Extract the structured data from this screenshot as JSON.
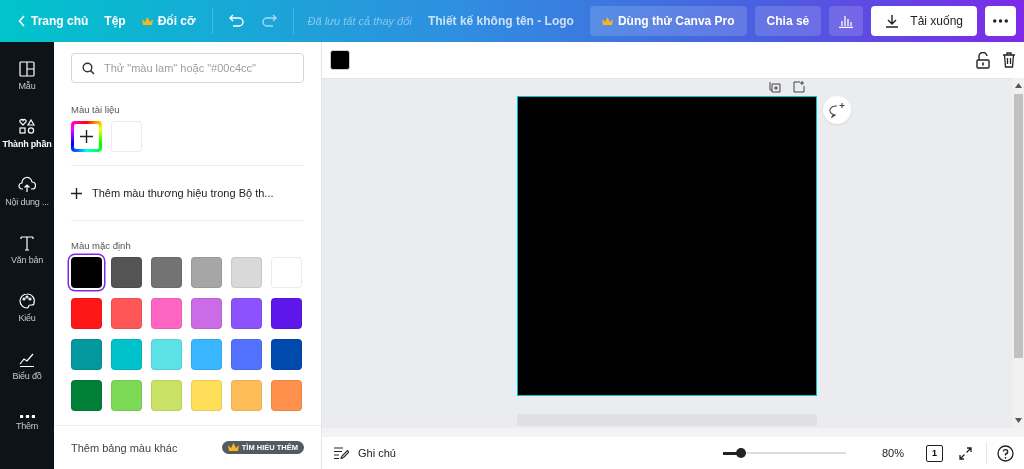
{
  "top_bar": {
    "back": "Trang chủ",
    "menu": [
      {
        "label": "Tệp",
        "kind": "plain"
      },
      {
        "label": "Đổi cỡ",
        "kind": "crown"
      }
    ],
    "save_status": "Đã lưu tất cả thay đổi",
    "title": "Thiết kế không tên - Logo",
    "pro_button": "Dùng thử Canva Pro",
    "share_button": "Chia sẻ",
    "download_button": "Tải xuống"
  },
  "sidebar": {
    "items": [
      {
        "label": "Mẫu",
        "selected": false
      },
      {
        "label": "Thành phần",
        "selected": true
      },
      {
        "label": "Nội dung ...",
        "selected": false
      },
      {
        "label": "Văn bản",
        "selected": false
      },
      {
        "label": "Kiểu",
        "selected": false
      },
      {
        "label": "Biểu đồ",
        "selected": false
      },
      {
        "label": "Thêm",
        "selected": false
      }
    ]
  },
  "panel": {
    "search": {
      "placeholder": "Thử \"màu lam\" hoặc \"#00c4cc\""
    },
    "document_colors_label": "Màu tài liệu",
    "document_colors": [
      {
        "color": "#ffffff"
      }
    ],
    "brand_link": "Thêm màu thương hiệu trong Bộ th...",
    "default_colors_label": "Màu mặc định",
    "default_colors": [
      {
        "color": "#000000",
        "selected": true
      },
      {
        "color": "#545454",
        "selected": false
      },
      {
        "color": "#737373",
        "selected": false
      },
      {
        "color": "#a6a6a6",
        "selected": false
      },
      {
        "color": "#d9d9d9",
        "selected": false
      },
      {
        "color": "#ffffff",
        "selected": false
      },
      {
        "color": "#ff1616",
        "selected": false
      },
      {
        "color": "#ff5757",
        "selected": false
      },
      {
        "color": "#ff66c4",
        "selected": false
      },
      {
        "color": "#cb6ce6",
        "selected": false
      },
      {
        "color": "#8c52ff",
        "selected": false
      },
      {
        "color": "#5e17eb",
        "selected": false
      },
      {
        "color": "#03989e",
        "selected": false
      },
      {
        "color": "#00c2cb",
        "selected": false
      },
      {
        "color": "#5ce1e6",
        "selected": false
      },
      {
        "color": "#38b6ff",
        "selected": false
      },
      {
        "color": "#5271ff",
        "selected": false
      },
      {
        "color": "#004aad",
        "selected": false
      },
      {
        "color": "#008037",
        "selected": false
      },
      {
        "color": "#7ed957",
        "selected": false
      },
      {
        "color": "#c9e265",
        "selected": false
      },
      {
        "color": "#ffde59",
        "selected": false
      },
      {
        "color": "#ffbd59",
        "selected": false
      },
      {
        "color": "#ff914d",
        "selected": false
      }
    ],
    "footer_text": "Thêm bảng màu khác",
    "footer_badge": "TÌM HIỂU THÊM"
  },
  "bottom_bar": {
    "notes": "Ghi chú",
    "zoom": {
      "level": 0.15
    },
    "zoom_label": "80%",
    "page_count": "1"
  }
}
